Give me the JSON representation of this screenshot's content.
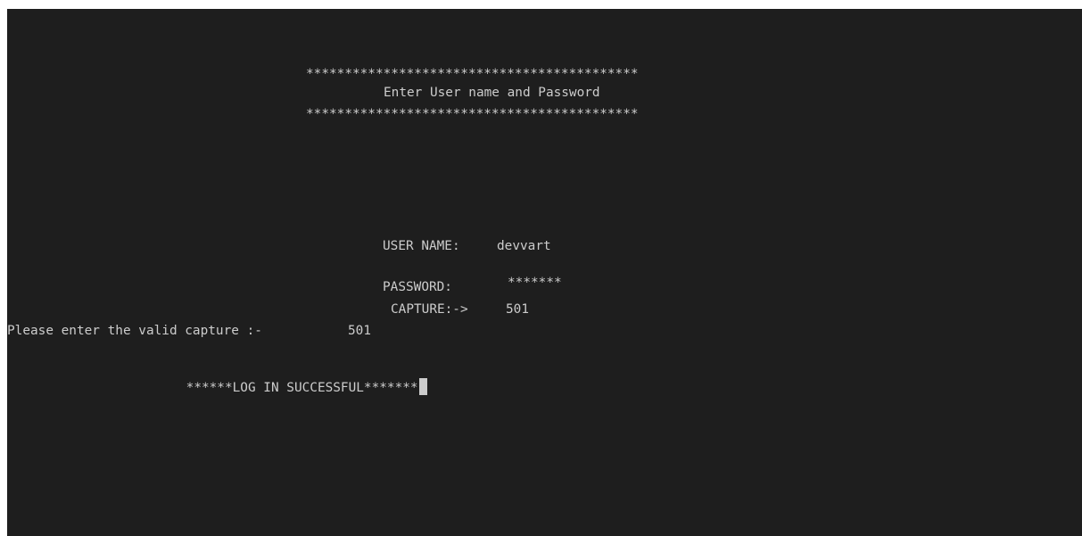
{
  "console": {
    "banner_top": "*******************************************",
    "banner_title": "Enter User name and Password",
    "banner_bottom": "*******************************************",
    "username_label": "USER NAME:",
    "username_value": "devvart",
    "password_label": "PASSWORD:",
    "password_value": "*******",
    "capture_label": "CAPTURE:->",
    "capture_value": "501",
    "valid_prompt": "Please enter the valid capture :-",
    "valid_value": "501",
    "success_message": "******LOG IN SUCCESSFUL*******"
  },
  "colors": {
    "background": "#1e1e1e",
    "text": "#cccccc"
  }
}
